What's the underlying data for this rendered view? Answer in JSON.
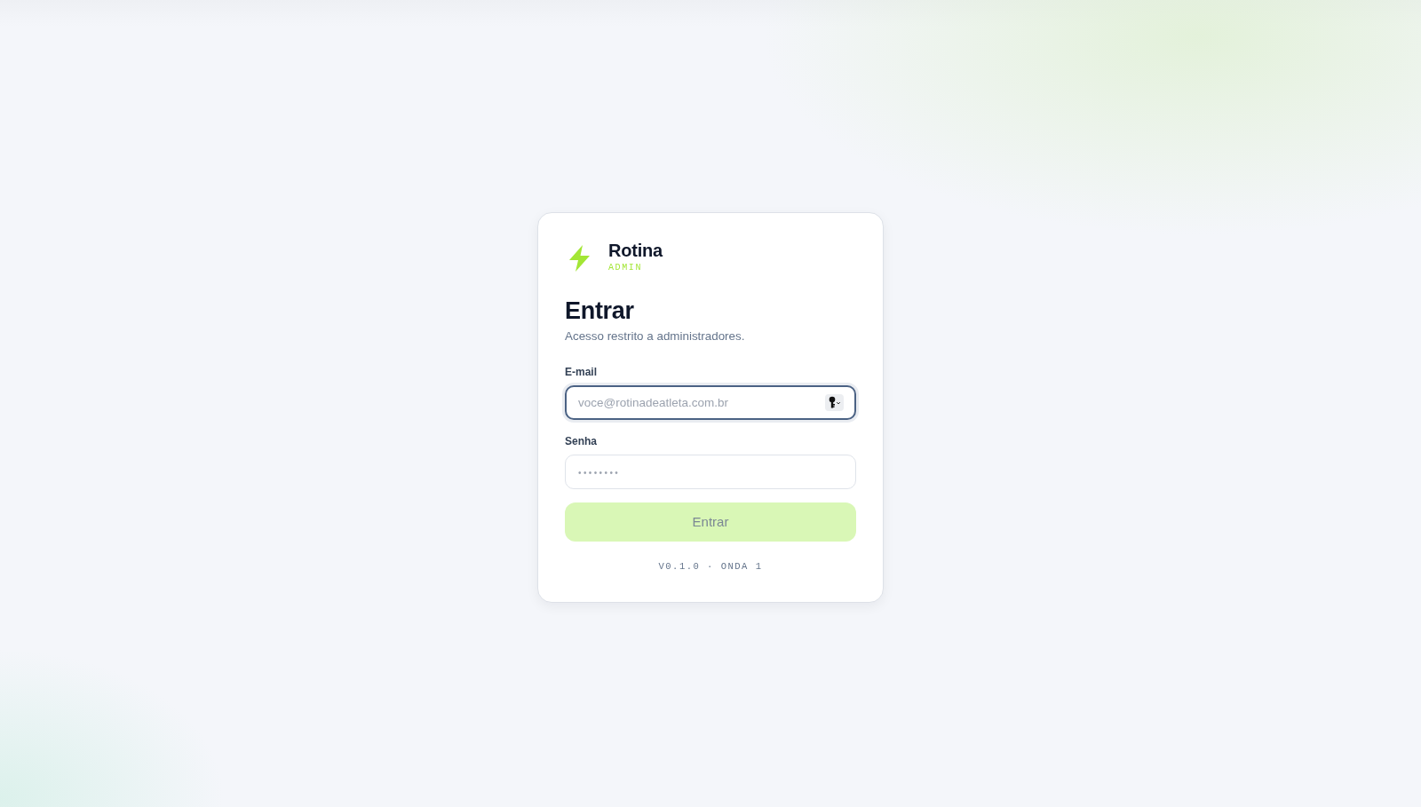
{
  "brand": {
    "name": "Rotina",
    "tag": "ADMIN"
  },
  "heading": "Entrar",
  "subtitle": "Acesso restrito a administradores.",
  "fields": [
    {
      "kind": "email",
      "label": "E-mail",
      "placeholder": "voce@rotinadeatleta.com.br",
      "focused": true,
      "key_icon": true
    },
    {
      "kind": "password",
      "label": "Senha",
      "placeholder": "••••••••",
      "focused": false,
      "key_icon": false
    }
  ],
  "submit": {
    "label": "Entrar",
    "disabled": true
  },
  "footer": "V0.1.0 · ONDA 1"
}
